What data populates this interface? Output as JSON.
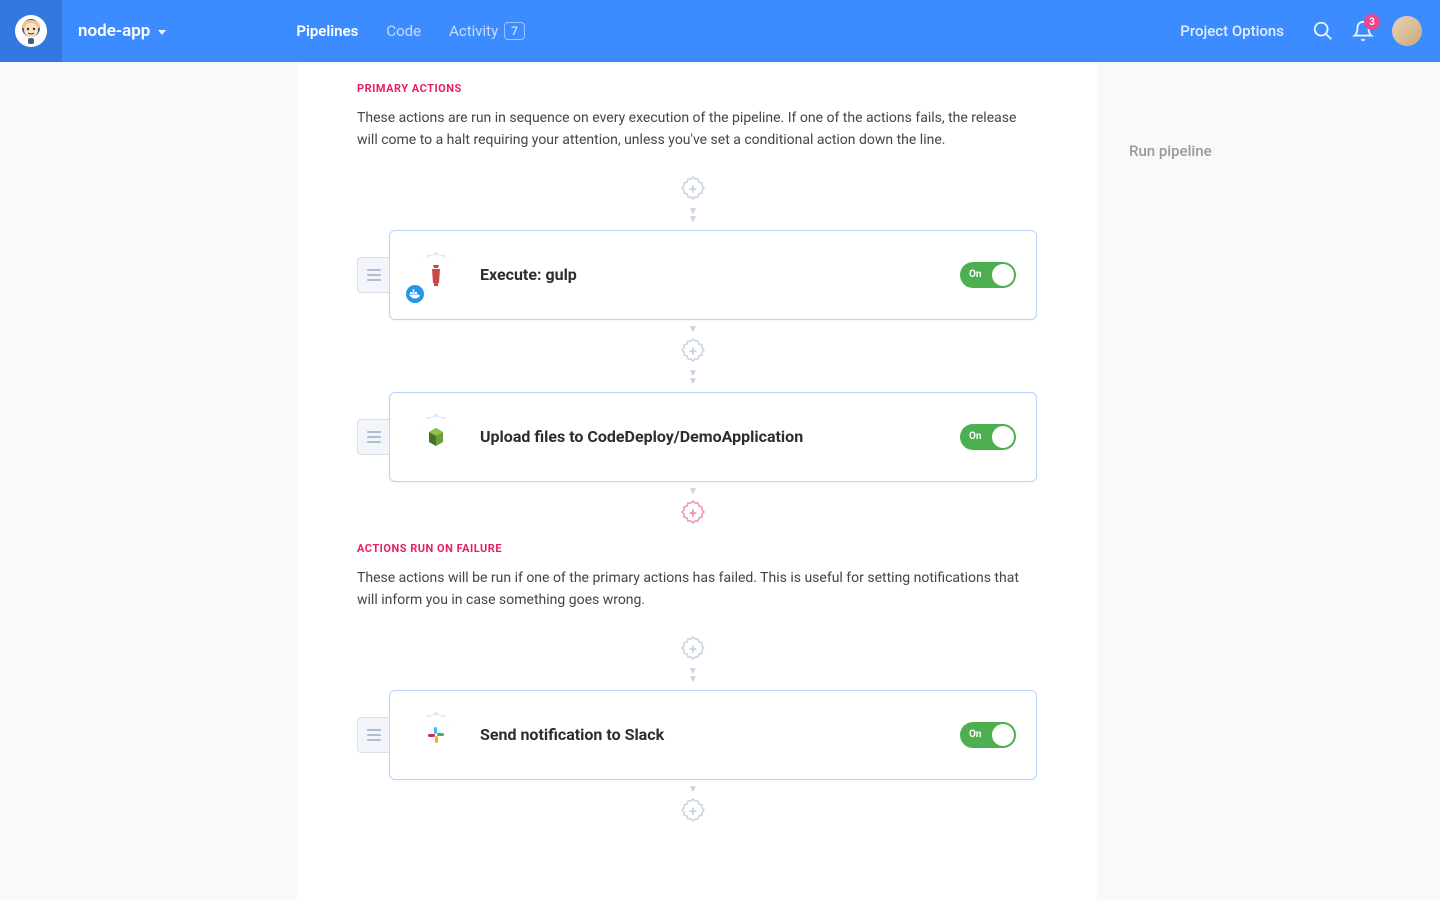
{
  "header": {
    "project_name": "node-app",
    "nav": {
      "pipelines": "Pipelines",
      "code": "Code",
      "activity": "Activity",
      "activity_count": "7"
    },
    "options": "Project Options",
    "notifications_count": "3"
  },
  "sections": {
    "primary": {
      "title": "PRIMARY ACTIONS",
      "description": "These actions are run in sequence on every execution of the pipeline. If one of the actions fails, the release will come to a halt requiring your attention, unless you've set a conditional action down the line."
    },
    "failure": {
      "title": "ACTIONS RUN ON FAILURE",
      "description": "These actions will be run if one of the primary actions has failed. This is useful for setting notifications that will inform you in case something goes wrong."
    }
  },
  "actions": {
    "gulp": {
      "title": "Execute: gulp",
      "toggle": "On"
    },
    "codedeploy": {
      "title": "Upload files to CodeDeploy/DemoApplication",
      "toggle": "On"
    },
    "slack": {
      "title": "Send notification to Slack",
      "toggle": "On"
    }
  },
  "sidebar": {
    "run_pipeline": "Run pipeline"
  }
}
